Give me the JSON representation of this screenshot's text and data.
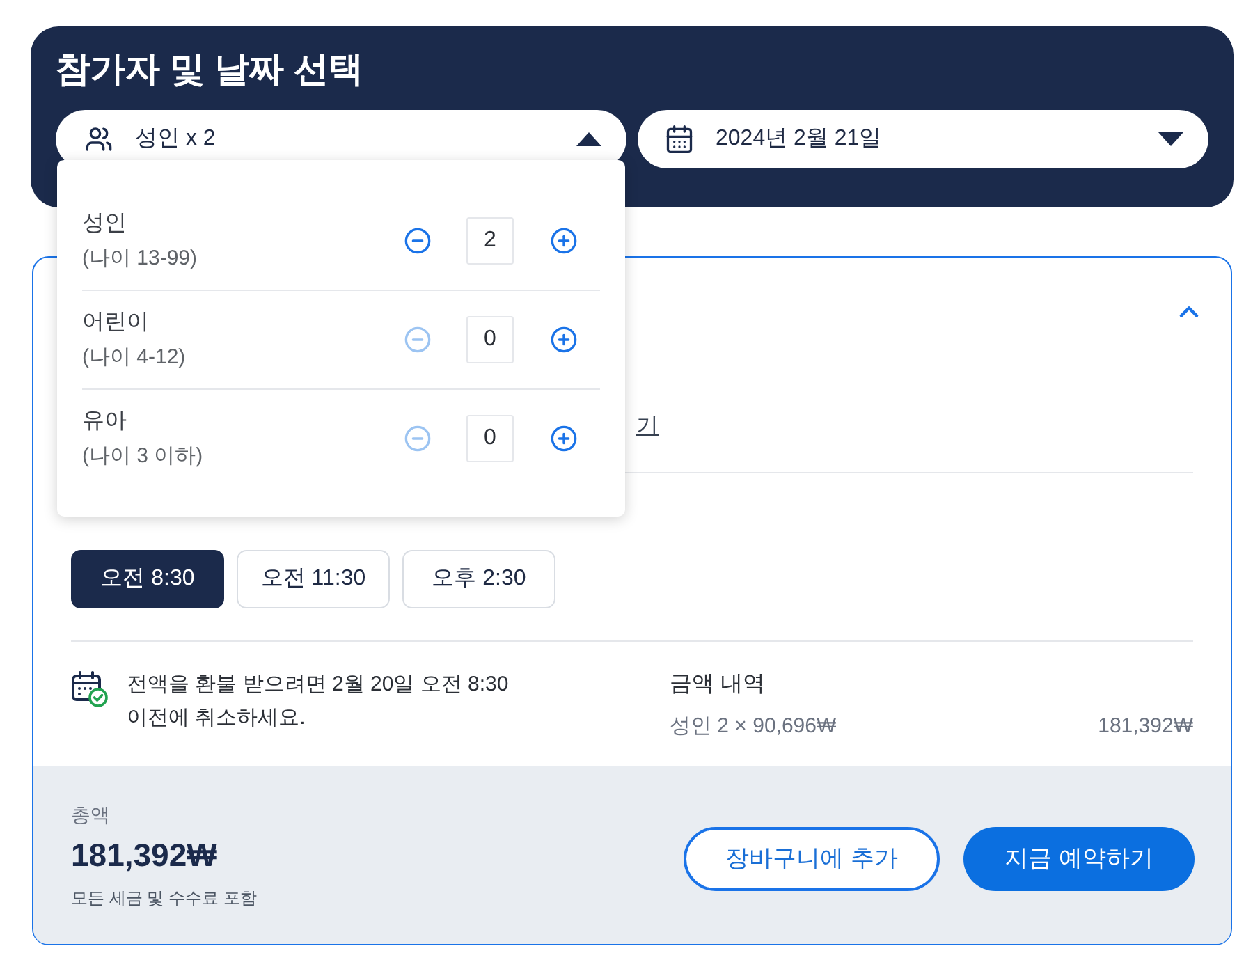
{
  "header": {
    "title": "참가자 및 날짜 선택",
    "participants_select": {
      "value": "성인 x 2",
      "expanded": true
    },
    "date_select": {
      "value": "2024년 2월 21일",
      "expanded": false
    }
  },
  "participants_dropdown": {
    "rows": [
      {
        "label": "성인",
        "age": "(나이 13-99)",
        "count": "2",
        "decrease_disabled": false
      },
      {
        "label": "어린이",
        "age": "(나이 4-12)",
        "count": "0",
        "decrease_disabled": true
      },
      {
        "label": "유아",
        "age": "(나이 3 이하)",
        "count": "0",
        "decrease_disabled": true
      }
    ]
  },
  "card": {
    "expanded": true,
    "link_fragment": "기",
    "times": [
      {
        "label": "오전 8:30",
        "selected": true
      },
      {
        "label": "오전 11:30",
        "selected": false
      },
      {
        "label": "오후 2:30",
        "selected": false
      }
    ],
    "refund_note": "전액을 환불 받으려면 2월 20일 오전 8:30 이전에 취소하세요.",
    "price_breakdown": {
      "title": "금액 내역",
      "lines": [
        {
          "label": "성인 2 × 90,696₩",
          "amount": "181,392₩"
        }
      ]
    },
    "footer": {
      "total_label": "총액",
      "total": "181,392₩",
      "tax_note": "모든 세금 및 수수료 포함",
      "buttons": [
        {
          "label": "장바구니에 추가",
          "kind": "outline"
        },
        {
          "label": "지금 예약하기",
          "kind": "primary"
        }
      ]
    }
  }
}
